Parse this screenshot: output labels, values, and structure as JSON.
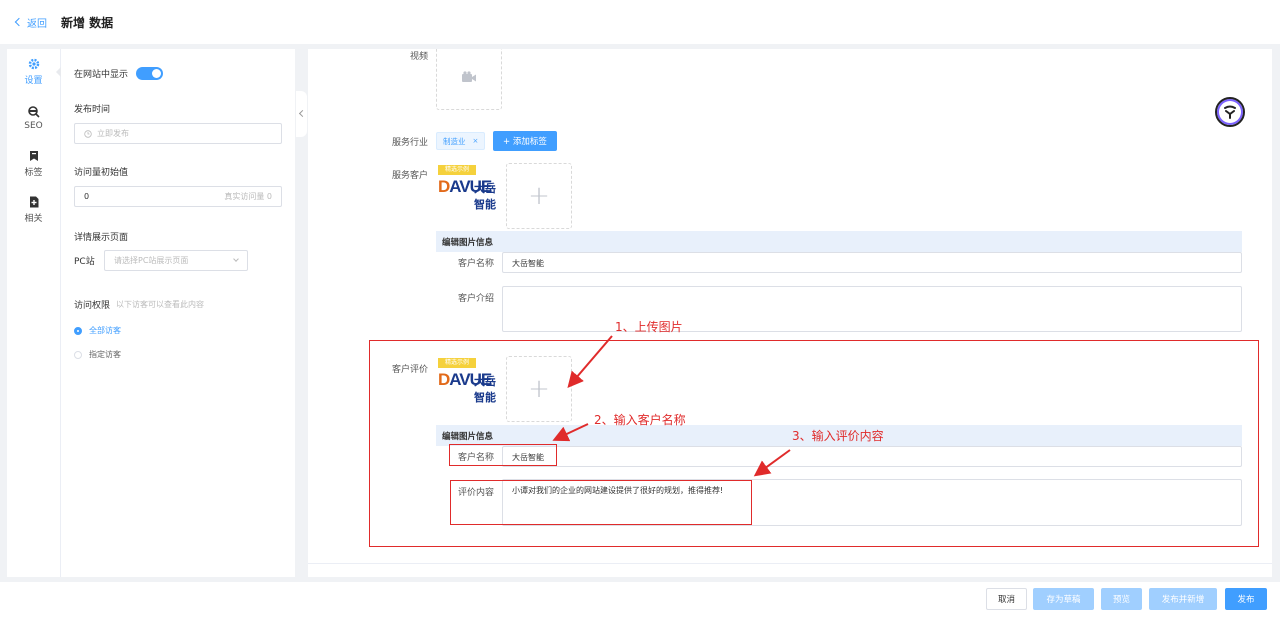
{
  "header": {
    "back_label": "返回",
    "title": "新增 数据"
  },
  "rail": {
    "items": [
      {
        "label": "设置",
        "icon": "gear-icon"
      },
      {
        "label": "SEO",
        "icon": "seo-icon"
      },
      {
        "label": "标签",
        "icon": "bookmark-icon"
      },
      {
        "label": "相关",
        "icon": "related-doc-icon"
      }
    ]
  },
  "settings": {
    "show_on_site_label": "在网站中显示",
    "publish_time_label": "发布时间",
    "publish_time_placeholder": "立即发布",
    "views_initial_label": "访问量初始值",
    "views_initial_value": "0",
    "views_real_text": "真实访问量 0",
    "detail_page_label": "详情展示页面",
    "pc_label": "PC站",
    "pc_placeholder": "请选择PC站展示页面",
    "access_label": "访问权限",
    "access_hint": "以下访客可以查看此内容",
    "access_all": "全部访客",
    "access_specified": "指定访客"
  },
  "form": {
    "video_label": "视频",
    "industry_label": "服务行业",
    "industry_tag": "制造业",
    "add_tag_button": "+ 添加标签",
    "client_label": "服务客户",
    "edit_image_info": "编辑图片信息",
    "client_name_label": "客户名称",
    "client_name_value": "大岳智能",
    "client_intro_label": "客户介绍",
    "review_label": "客户评价",
    "review_name_label": "客户名称",
    "review_name_value": "大岳智能",
    "review_content_label": "评价内容",
    "review_content_value": "小谭对我们的企业的网站建设提供了很好的规划，推得推荐!",
    "logo_badge": "精选示例",
    "logo_word_d": "D",
    "logo_word_rest": "AVUE",
    "logo_cn": "大岳智能"
  },
  "annotations": {
    "step1": "1、上传图片",
    "step2": "2、输入客户名称",
    "step3": "3、输入评价内容"
  },
  "footer": {
    "cancel": "取消",
    "save_draft": "存为草稿",
    "preview": "预览",
    "publish_new": "发布并新增",
    "publish": "发布"
  },
  "colors": {
    "accent": "#409eff",
    "annotation": "#e02b2b"
  }
}
